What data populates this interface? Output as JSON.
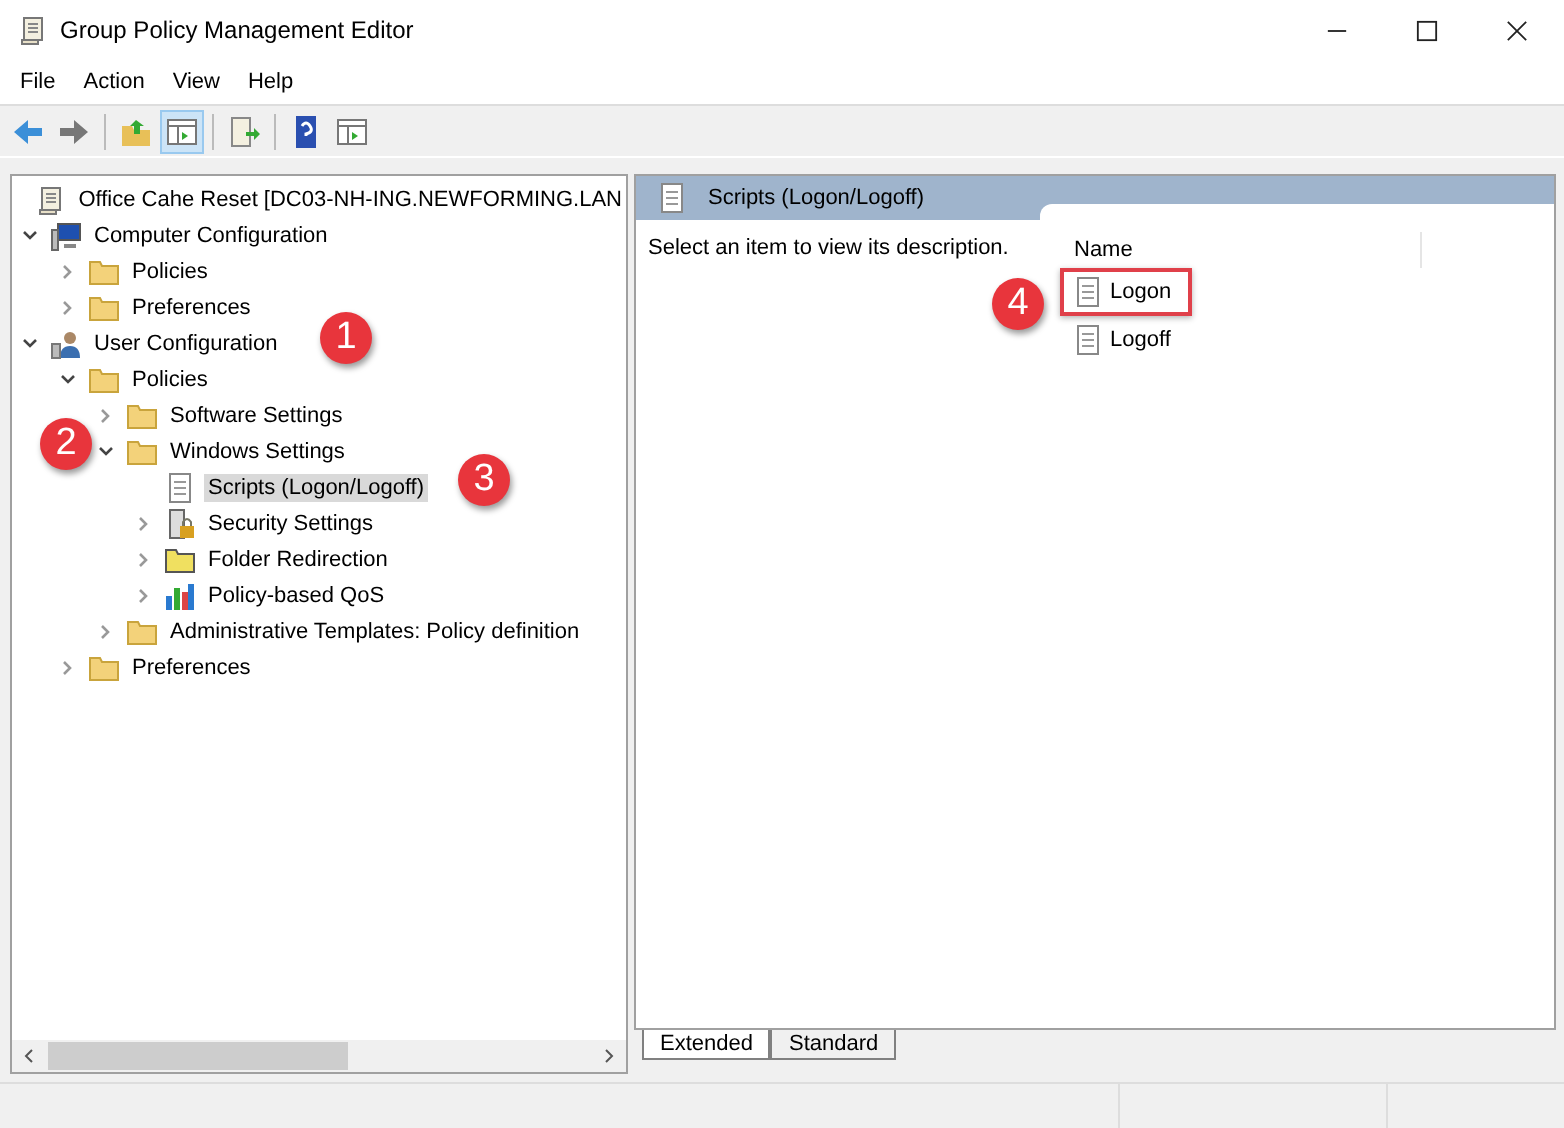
{
  "window": {
    "title": "Group Policy Management Editor"
  },
  "menu": [
    "File",
    "Action",
    "View",
    "Help"
  ],
  "toolbar": [
    {
      "kind": "back",
      "pressed": false
    },
    {
      "kind": "forward",
      "pressed": false
    },
    {
      "kind": "up",
      "pressed": false
    },
    {
      "kind": "pane",
      "pressed": true
    },
    {
      "kind": "export",
      "pressed": false
    },
    {
      "kind": "help",
      "pressed": false
    },
    {
      "kind": "pane2",
      "pressed": false
    }
  ],
  "tree": [
    {
      "label": "Office Cahe Reset [DC03-NH-ING.NEWFORMING.LAN",
      "kind": "scroll",
      "selected": false,
      "children": [
        {
          "label": "Computer Configuration",
          "kind": "computer",
          "expanded": true,
          "selected": false,
          "children": [
            {
              "label": "Policies",
              "kind": "folder",
              "expanded": false,
              "selected": false
            },
            {
              "label": "Preferences",
              "kind": "folder",
              "expanded": false,
              "selected": false
            }
          ]
        },
        {
          "label": "User Configuration",
          "kind": "user",
          "expanded": true,
          "selected": false,
          "children": [
            {
              "label": "Policies",
              "kind": "folder",
              "expanded": true,
              "selected": false,
              "children": [
                {
                  "label": "Software Settings",
                  "kind": "folder",
                  "expanded": false,
                  "selected": false
                },
                {
                  "label": "Windows Settings",
                  "kind": "folder",
                  "expanded": true,
                  "selected": false,
                  "children": [
                    {
                      "label": "Scripts (Logon/Logoff)",
                      "kind": "script",
                      "selected": true
                    },
                    {
                      "label": "Security Settings",
                      "kind": "security",
                      "expanded": false,
                      "selected": false
                    },
                    {
                      "label": "Folder Redirection",
                      "kind": "redirect",
                      "expanded": false,
                      "selected": false
                    },
                    {
                      "label": "Policy-based QoS",
                      "kind": "chart",
                      "expanded": false,
                      "selected": false
                    }
                  ]
                },
                {
                  "label": "Administrative Templates: Policy definition",
                  "kind": "folder",
                  "expanded": false,
                  "selected": false
                }
              ]
            },
            {
              "label": "Preferences",
              "kind": "folder",
              "expanded": false,
              "selected": false
            }
          ]
        }
      ]
    }
  ],
  "details": {
    "header": "Scripts (Logon/Logoff)",
    "description": "Select an item to view its description.",
    "column": "Name",
    "items": [
      {
        "label": "Logon",
        "highlighted": true
      },
      {
        "label": "Logoff",
        "highlighted": false
      }
    ]
  },
  "tabs": [
    {
      "label": "Extended",
      "selected": true
    },
    {
      "label": "Standard",
      "selected": false
    }
  ],
  "callouts": [
    {
      "label": "1"
    },
    {
      "label": "2"
    },
    {
      "label": "3"
    },
    {
      "label": "4"
    }
  ]
}
